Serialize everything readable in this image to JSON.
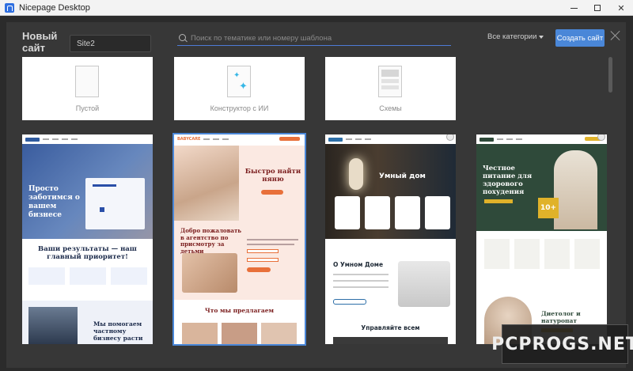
{
  "window": {
    "title": "Nicepage Desktop"
  },
  "dialog": {
    "heading": "Новый сайт",
    "site_name_value": "Site2",
    "search_placeholder": "Поиск по тематике или номеру шаблона",
    "categories_label": "Все категории",
    "create_button": "Создать сайт"
  },
  "top_cards": [
    {
      "label": "Пустой",
      "icon": "blank-page-icon"
    },
    {
      "label": "Конструктор с ИИ",
      "icon": "ai-sparkle-icon"
    },
    {
      "label": "Схемы",
      "icon": "layout-schema-icon"
    }
  ],
  "templates": [
    {
      "hero_title": "Просто заботимся о вашем бизнесе",
      "section_title": "Ваши результаты — наш главный приоритет!",
      "bottom_title": "Мы помогаем частному бизнесу расти",
      "accent": "#2a4fa8"
    },
    {
      "logo": "BABYCARE",
      "hero_title": "Быстро найти няню",
      "section_title": "Добро пожаловать в агентство по присмотру за детьми",
      "bottom_title": "Что мы предлагаем",
      "accent": "#e8703a"
    },
    {
      "hero_title": "Умный дом",
      "section_title": "О Умном Доме",
      "bottom_title": "Управляйте всем",
      "accent": "#1f2a36"
    },
    {
      "hero_title": "Честное питание для здорового похудения",
      "badge": "10+",
      "bottom_title": "Диетолог и натуропат",
      "accent": "#2f4a3a"
    }
  ],
  "watermark": "PCPROGS.NET"
}
